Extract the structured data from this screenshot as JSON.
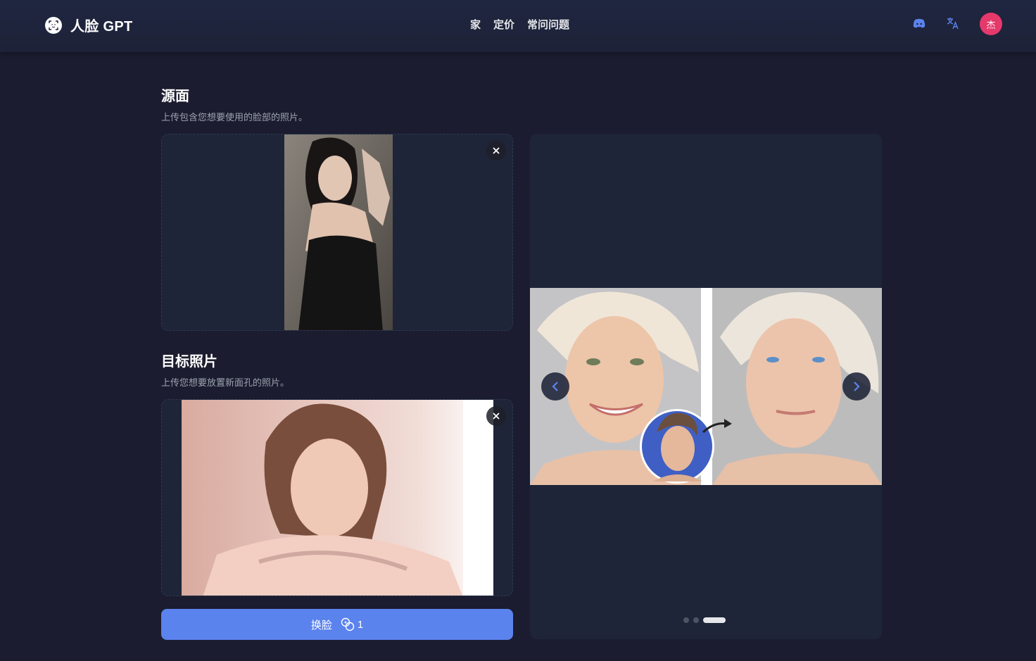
{
  "header": {
    "brand": "人脸 GPT",
    "nav": [
      {
        "label": "家"
      },
      {
        "label": "定价"
      },
      {
        "label": "常问问题"
      }
    ],
    "avatar_initial": "杰",
    "icons": [
      "discord-icon",
      "translate-icon"
    ]
  },
  "source": {
    "title": "源面",
    "description": "上传包含您想要使用的脸部的照片。"
  },
  "target": {
    "title": "目标照片",
    "description": "上传您想要放置新面孔的照片。"
  },
  "action": {
    "label": "换脸",
    "credits": "1"
  },
  "carousel": {
    "slide_count": 3,
    "active_index": 2
  },
  "colors": {
    "accent": "#5b83ee",
    "avatar": "#e5396b",
    "background": "#1b1c2f",
    "panel": "#1e2538"
  }
}
